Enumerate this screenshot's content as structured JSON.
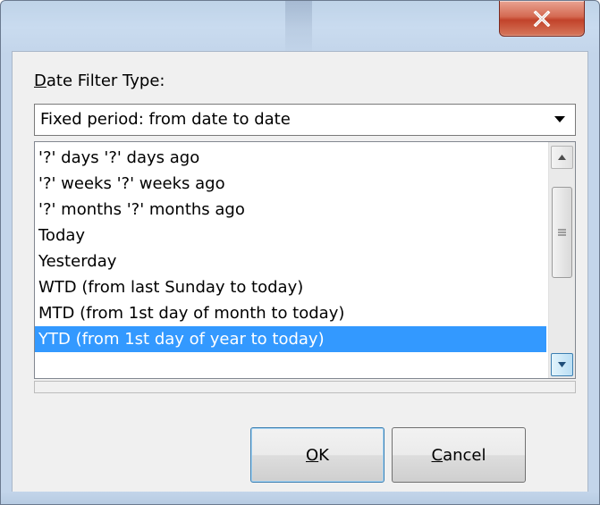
{
  "window": {
    "close_icon": "close-x-icon"
  },
  "filter": {
    "label_mnemonic": "D",
    "label_rest": "ate Filter Type:",
    "selected_value": "Fixed period: from date to date"
  },
  "list": {
    "items": [
      "'?' days '?' days ago",
      "'?' weeks '?' weeks ago",
      "'?' months '?' months ago",
      "Today",
      "Yesterday",
      "WTD (from last Sunday to today)",
      "MTD (from 1st day of month to today)",
      "YTD (from 1st day of year to today)"
    ],
    "selected_index": 7
  },
  "buttons": {
    "ok_mnemonic": "O",
    "ok_rest": "K",
    "cancel_mnemonic": "C",
    "cancel_rest": "ancel"
  },
  "colors": {
    "selection": "#3399ff",
    "close_button": "#c2432a"
  }
}
